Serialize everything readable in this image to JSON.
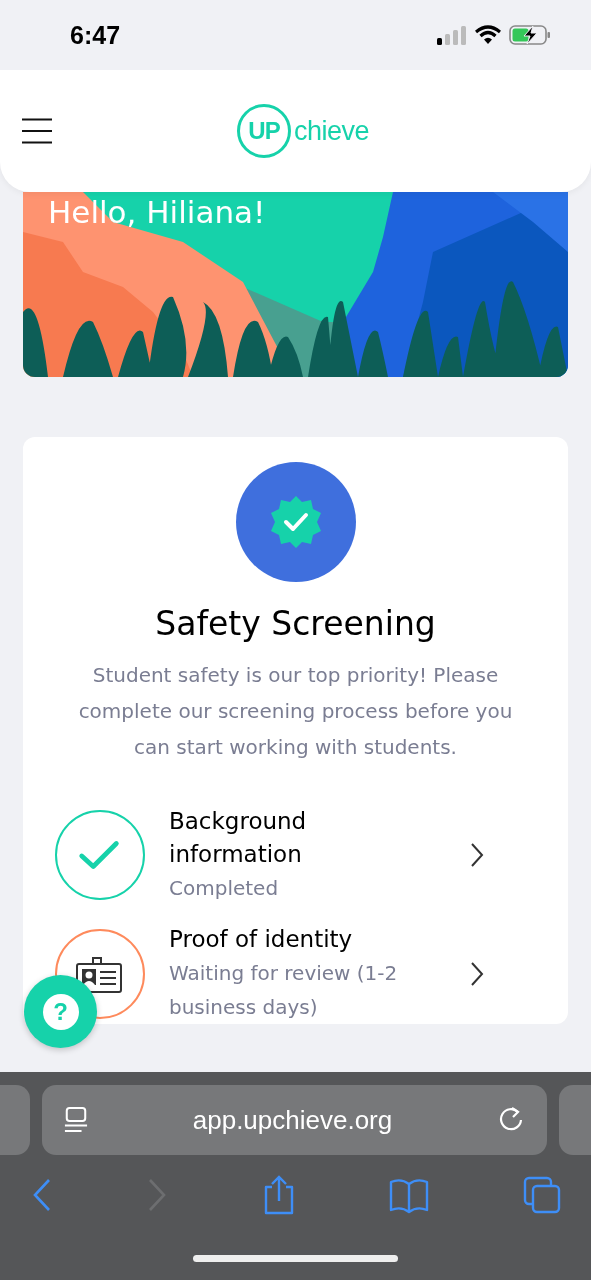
{
  "status_bar": {
    "time": "6:47"
  },
  "header": {
    "logo": {
      "badge": "UP",
      "text": "chieve"
    }
  },
  "greeting": "Hello, Hiliana!",
  "screening": {
    "title": "Safety Screening",
    "description": "Student safety is our top priority! Please complete our screening process before you can start working with students.",
    "steps": [
      {
        "kind": "completed",
        "title": "Background information",
        "status": "Completed"
      },
      {
        "kind": "pending",
        "title": "Proof of identity",
        "status": "Waiting for review (1-2 business days)"
      }
    ]
  },
  "help_button": {
    "label": "?"
  },
  "browser": {
    "url": "app.upchieve.org"
  }
}
